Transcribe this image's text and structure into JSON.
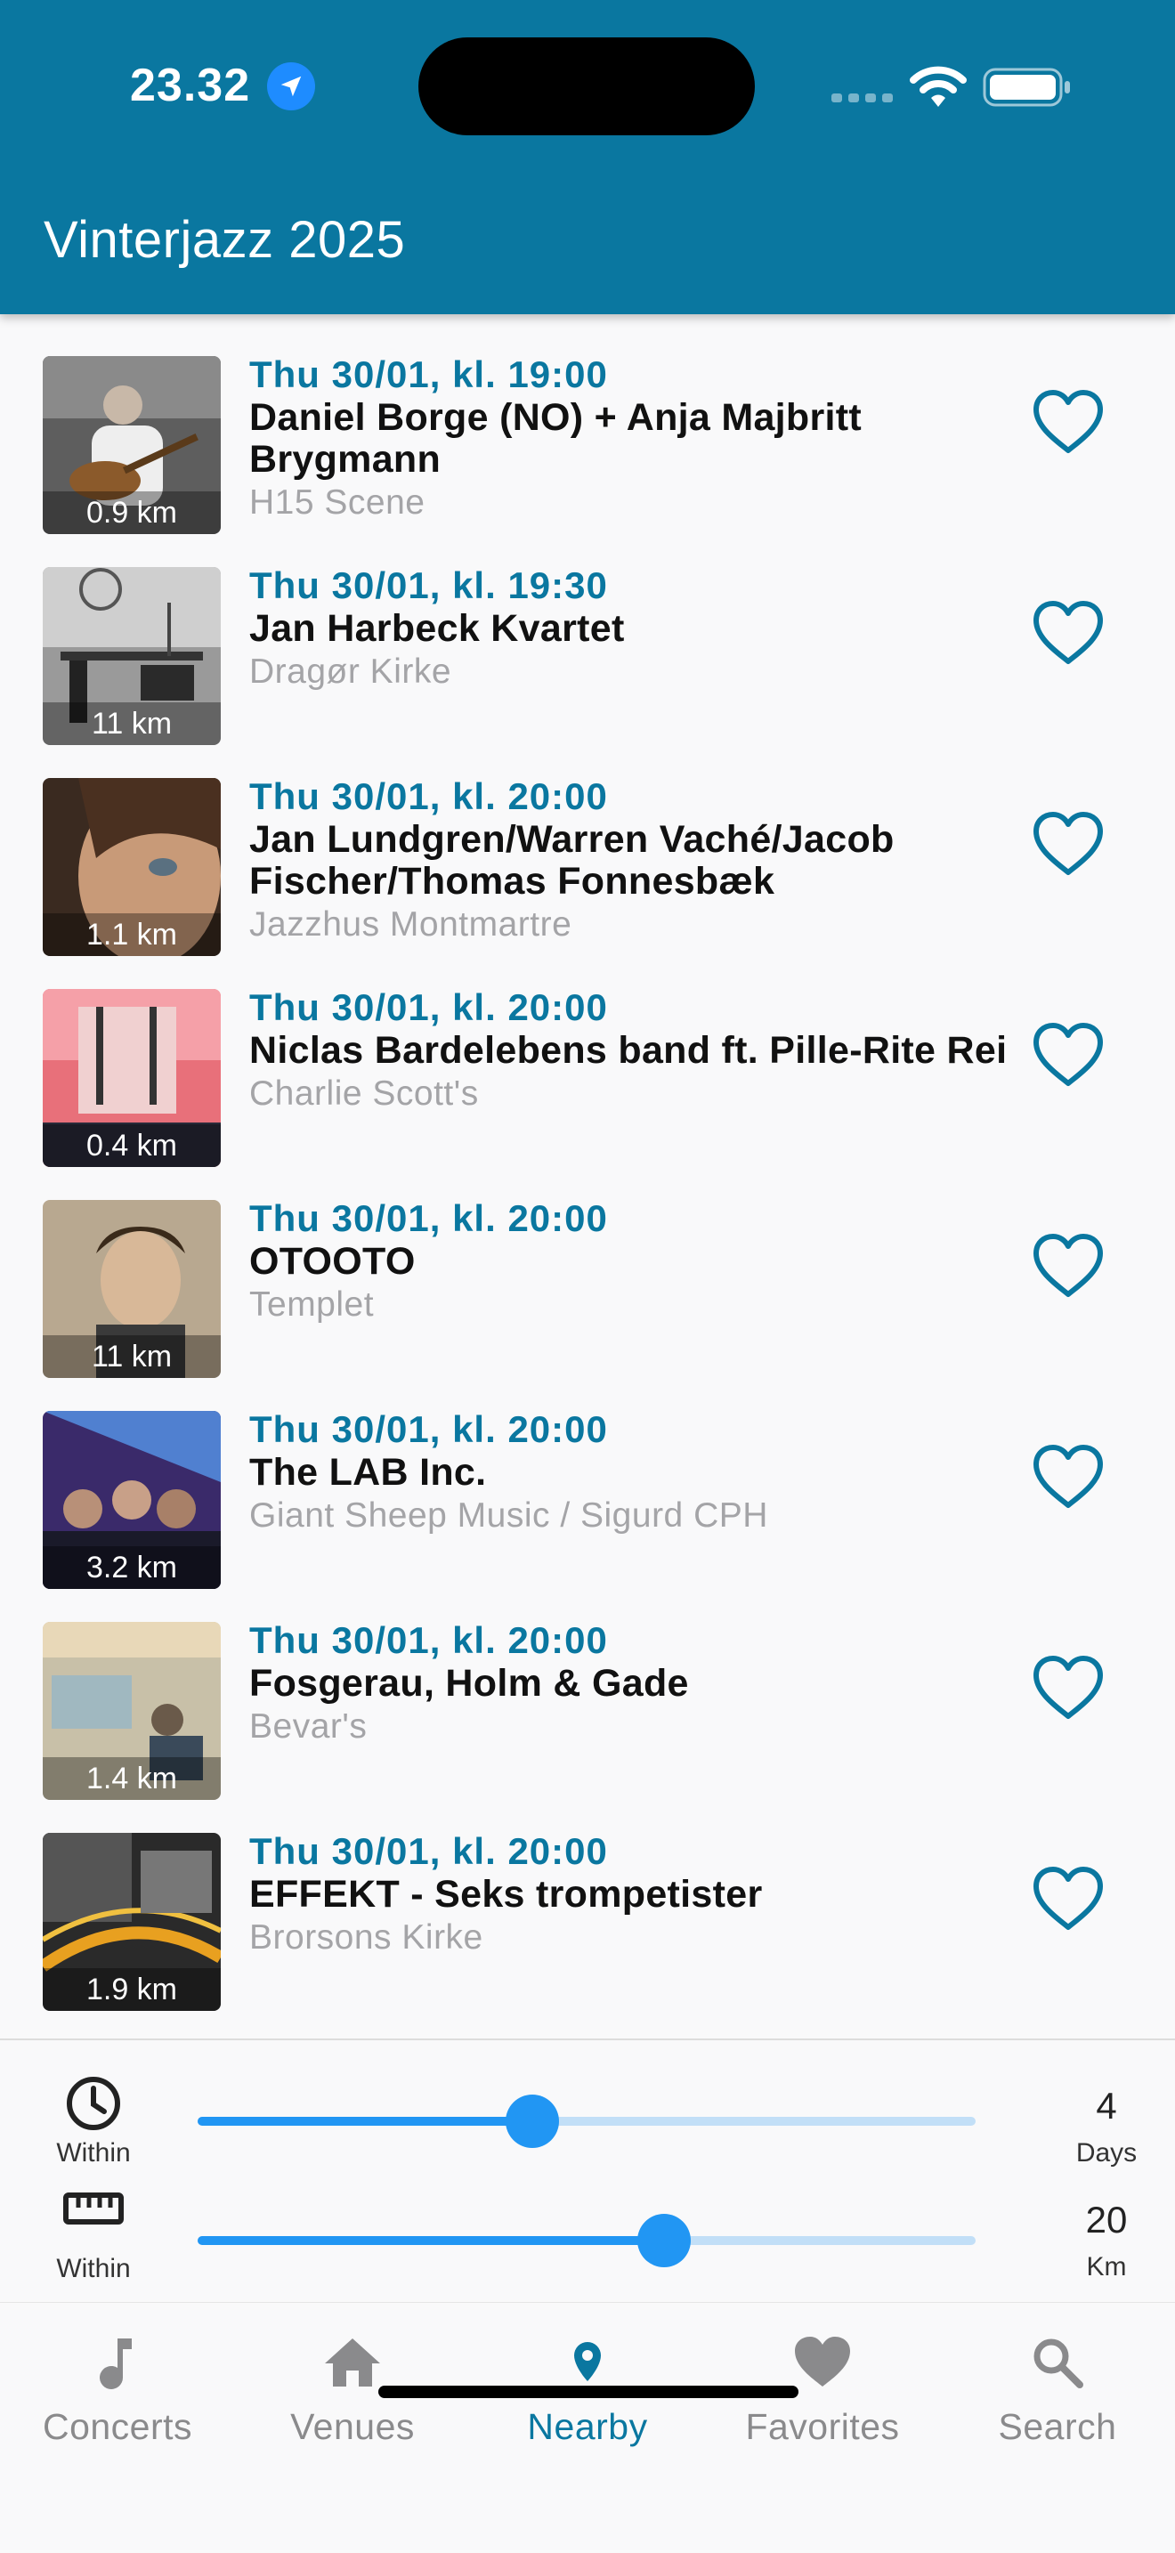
{
  "status_bar": {
    "time": "23.32"
  },
  "app_bar": {
    "title": "Vinterjazz 2025"
  },
  "events": [
    {
      "date": "Thu 30/01, kl. 19:00",
      "title": "Daniel Borge (NO) + Anja Majbritt Brygmann",
      "venue": "H15 Scene",
      "distance": "0.9 km",
      "favorite": false
    },
    {
      "date": "Thu 30/01, kl. 19:30",
      "title": "Jan Harbeck Kvartet",
      "venue": "Dragør Kirke",
      "distance": "11 km",
      "favorite": false
    },
    {
      "date": "Thu 30/01, kl. 20:00",
      "title": "Jan Lundgren/Warren Vaché/Jacob Fischer/Thomas Fonnesbæk",
      "venue": "Jazzhus Montmartre",
      "distance": "1.1 km",
      "favorite": false
    },
    {
      "date": "Thu 30/01, kl. 20:00",
      "title": "Niclas Bardelebens band ft. Pille-Rite Rei",
      "venue": "Charlie Scott's",
      "distance": "0.4 km",
      "favorite": false
    },
    {
      "date": "Thu 30/01, kl. 20:00",
      "title": "OTOOTO",
      "venue": "Templet",
      "distance": "11 km",
      "favorite": false
    },
    {
      "date": "Thu 30/01, kl. 20:00",
      "title": "The LAB Inc.",
      "venue": "Giant Sheep Music / Sigurd CPH",
      "distance": "3.2 km",
      "favorite": false
    },
    {
      "date": "Thu 30/01, kl. 20:00",
      "title": "Fosgerau, Holm & Gade",
      "venue": "Bevar's",
      "distance": "1.4 km",
      "favorite": false
    },
    {
      "date": "Thu 30/01, kl. 20:00",
      "title": "EFFEKT - Seks trompetister",
      "venue": "Brorsons Kirke",
      "distance": "1.9 km",
      "favorite": false
    }
  ],
  "filters": {
    "time": {
      "icon": "clock-icon",
      "label": "Within",
      "value": "4",
      "unit": "Days",
      "slider_fraction": 0.43
    },
    "distance": {
      "icon": "ruler-icon",
      "label": "Within",
      "value": "20",
      "unit": "Km",
      "slider_fraction": 0.6
    }
  },
  "bottom_nav": [
    {
      "label": "Concerts",
      "icon": "music-note-icon",
      "active": false
    },
    {
      "label": "Venues",
      "icon": "home-icon",
      "active": false
    },
    {
      "label": "Nearby",
      "icon": "location-pin-icon",
      "active": true
    },
    {
      "label": "Favorites",
      "icon": "heart-icon",
      "active": false
    },
    {
      "label": "Search",
      "icon": "search-icon",
      "active": false
    }
  ],
  "colors": {
    "primary": "#0a77a0",
    "slider": "#2196f3",
    "slider_track": "#c2dff7",
    "venue_text": "#a4a4a7",
    "inactive_nav": "#8a8a8c"
  }
}
